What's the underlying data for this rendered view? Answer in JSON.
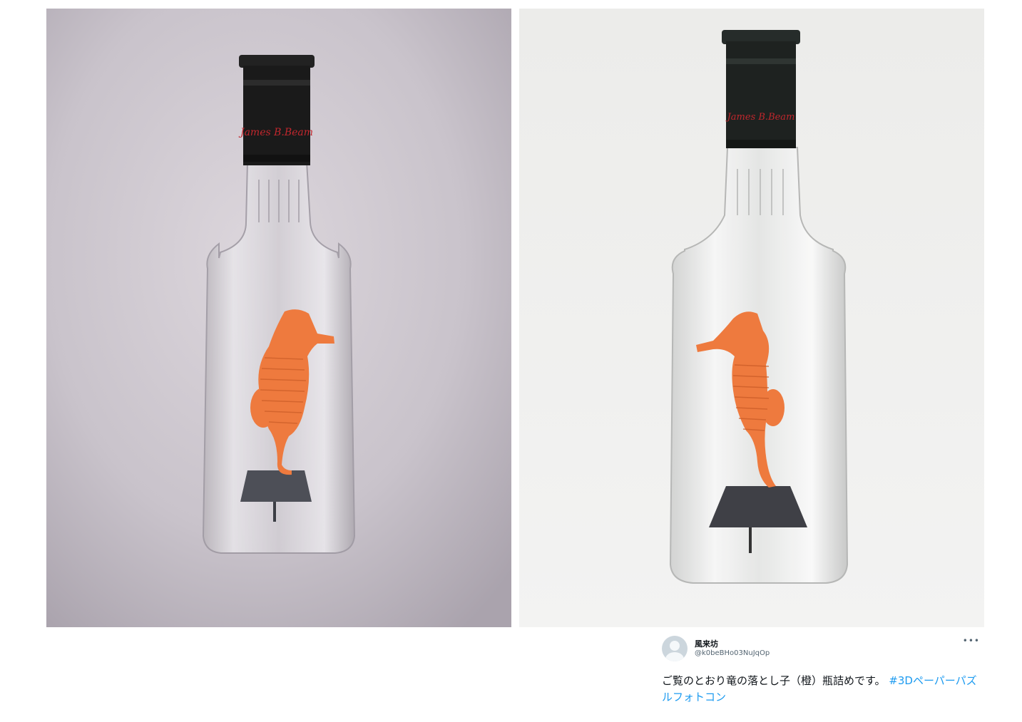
{
  "photos": [
    {
      "label_script": "James B Beam",
      "scene": "seahorse-in-bottle-left"
    },
    {
      "label_script": "James B Beam",
      "scene": "seahorse-in-bottle-right"
    }
  ],
  "tweet": {
    "display_name": "風来坊",
    "handle": "@k0beBHo03NuJqOp",
    "more_icon": "more-dots-icon",
    "text": "ご覧のとおり竜の落とし子（橙）瓶詰めです。",
    "hashtag": "#3Dペーパーパズルフォトコン"
  },
  "colors": {
    "seahorse": "#ee7a3e",
    "hashtag": "#1d9bf0",
    "cap": "#1a1a1a"
  }
}
